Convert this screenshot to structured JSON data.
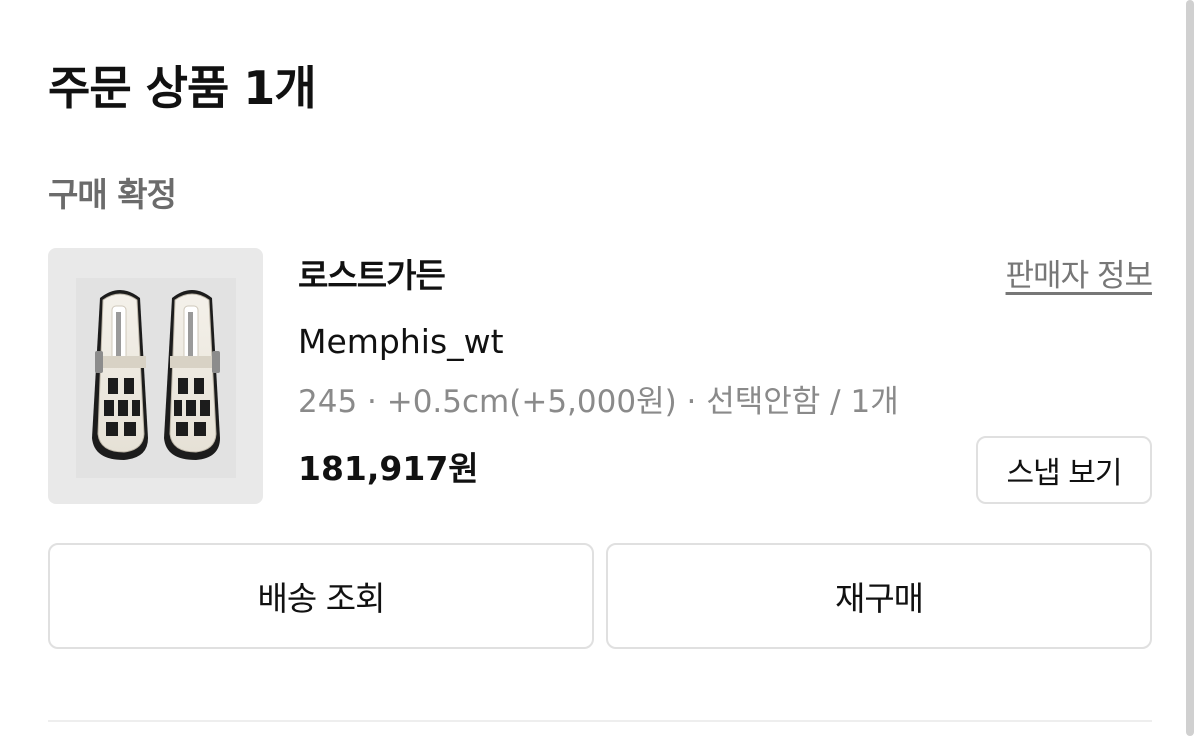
{
  "order_section": {
    "title": "주문 상품 1개",
    "status": "구매 확정"
  },
  "product": {
    "image_icon": "shoe-product-image",
    "brand": "로스트가든",
    "seller_info_link": "판매자 정보",
    "name": "Memphis_wt",
    "options": "245 · +0.5cm(+5,000원) · 선택안함 / 1개",
    "price": "181,917원",
    "snap_button": "스냅 보기"
  },
  "actions": {
    "delivery_button": "배송 조회",
    "rebuy_button": "재구매"
  },
  "colors": {
    "text_primary": "#111111",
    "text_secondary": "#6b6b6b",
    "text_muted": "#8a8a8a",
    "border": "#e0e0e0",
    "thumb_bg": "#e9e9e9"
  }
}
